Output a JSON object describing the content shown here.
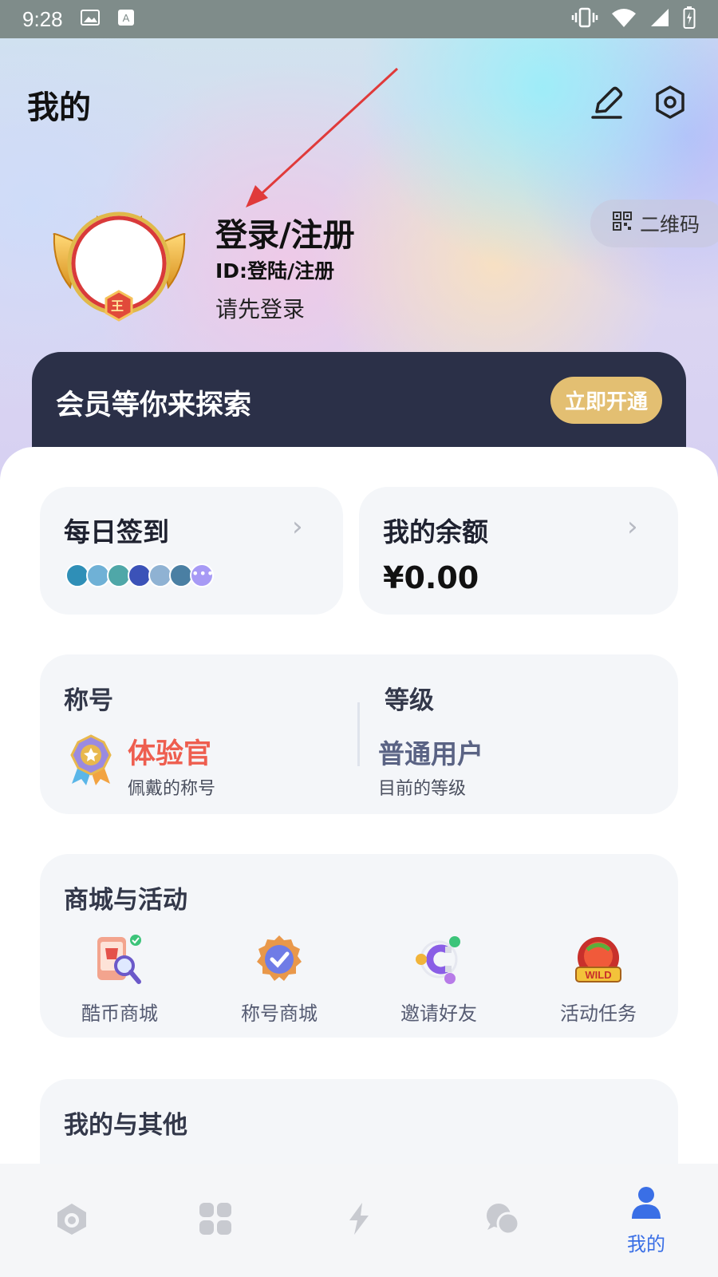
{
  "status_bar": {
    "time": "9:28"
  },
  "header": {
    "title": "我的",
    "qr_label": "二维码"
  },
  "user": {
    "name": "登录/注册",
    "id_text": "ID:登陆/注册",
    "hint": "请先登录",
    "badge": "王"
  },
  "vip": {
    "text": "会员等你来探索",
    "button": "立即开通"
  },
  "checkin": {
    "title": "每日签到",
    "avatar_colors": [
      "#2f8fb7",
      "#6fb1d6",
      "#4fa7a8",
      "#3b52b8",
      "#8fb2d3",
      "#4a7fa3",
      "#a79af5"
    ]
  },
  "balance": {
    "title": "我的余额",
    "amount": "¥0.00"
  },
  "title_level": {
    "title_label": "称号",
    "title_value": "体验官",
    "title_note": "佩戴的称号",
    "level_label": "等级",
    "level_value": "普通用户",
    "level_note": "目前的等级"
  },
  "mall": {
    "title": "商城与活动",
    "items": [
      {
        "label": "酷币商城",
        "icon": "shop-search-icon"
      },
      {
        "label": "称号商城",
        "icon": "badge-check-icon"
      },
      {
        "label": "邀请好友",
        "icon": "invite-magnet-icon"
      },
      {
        "label": "活动任务",
        "icon": "wild-event-icon"
      }
    ]
  },
  "others": {
    "title": "我的与其他"
  },
  "tabbar": {
    "active_label": "我的",
    "accent": "#3a6fe6",
    "inactive_color": "#c8cad0"
  }
}
